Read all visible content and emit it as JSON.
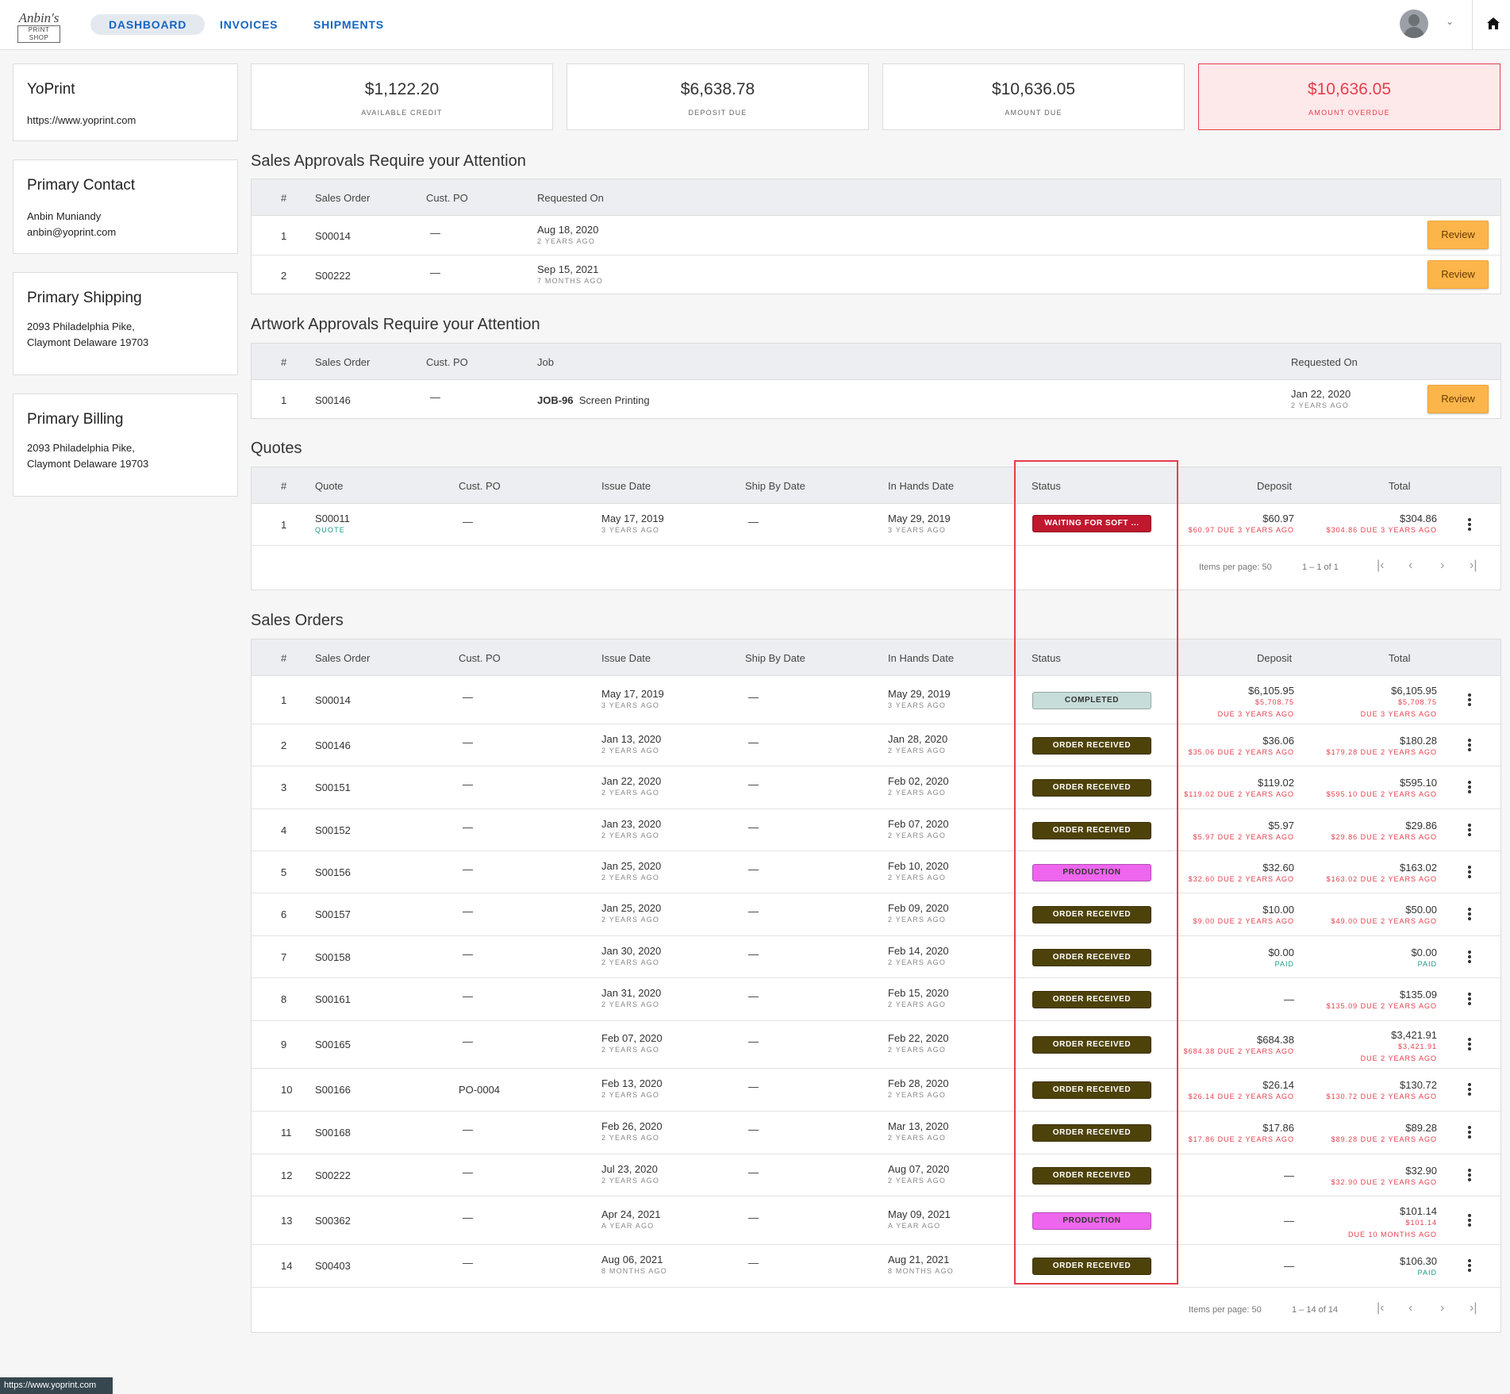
{
  "app": {
    "logo_line1": "Anbin's",
    "logo_line2": "PRINT SHOP"
  },
  "nav": [
    {
      "label": "DASHBOARD"
    },
    {
      "label": "INVOICES"
    },
    {
      "label": "SHIPMENTS"
    }
  ],
  "sidebar": {
    "company": {
      "title": "YoPrint",
      "url": "https://www.yoprint.com"
    },
    "contact": {
      "title": "Primary Contact",
      "name": "Anbin Muniandy",
      "email": "anbin@yoprint.com"
    },
    "shipping": {
      "title": "Primary Shipping",
      "line1": "2093 Philadelphia Pike,",
      "line2": "Claymont Delaware 19703"
    },
    "billing": {
      "title": "Primary Billing",
      "line1": "2093 Philadelphia Pike,",
      "line2": "Claymont Delaware 19703"
    }
  },
  "stats": [
    {
      "value": "$1,122.20",
      "label": "AVAILABLE CREDIT"
    },
    {
      "value": "$6,638.78",
      "label": "DEPOSIT DUE"
    },
    {
      "value": "$10,636.05",
      "label": "AMOUNT DUE"
    },
    {
      "value": "$10,636.05",
      "label": "AMOUNT OVERDUE"
    }
  ],
  "sales_approvals": {
    "title": "Sales Approvals Require your Attention",
    "headers": [
      "#",
      "Sales Order",
      "Cust. PO",
      "Requested On"
    ],
    "rows": [
      {
        "n": "1",
        "so": "S00014",
        "po": "—",
        "date": "Aug 18, 2020",
        "ago": "2 YEARS AGO",
        "action": "Review"
      },
      {
        "n": "2",
        "so": "S00222",
        "po": "—",
        "date": "Sep 15, 2021",
        "ago": "7 MONTHS AGO",
        "action": "Review"
      }
    ]
  },
  "artwork_approvals": {
    "title": "Artwork Approvals Require your Attention",
    "headers": [
      "#",
      "Sales Order",
      "Cust. PO",
      "Job",
      "Requested On"
    ],
    "rows": [
      {
        "n": "1",
        "so": "S00146",
        "po": "—",
        "job": "JOB-96",
        "job_desc": "Screen Printing",
        "date": "Jan 22, 2020",
        "ago": "2 YEARS AGO",
        "action": "Review"
      }
    ]
  },
  "quotes": {
    "title": "Quotes",
    "headers": [
      "#",
      "Quote",
      "Cust. PO",
      "Issue Date",
      "Ship By Date",
      "In Hands Date",
      "Status",
      "Deposit",
      "Total"
    ],
    "rows": [
      {
        "n": "1",
        "id": "S00011",
        "tag": "QUOTE",
        "po": "—",
        "issue": "May 17, 2019",
        "issue_ago": "3 YEARS AGO",
        "ship": "—",
        "hands": "May 29, 2019",
        "hands_ago": "3 YEARS AGO",
        "status": "WAITING FOR SOFT ...",
        "deposit": "$60.97",
        "deposit_note": "$60.97 DUE 3 YEARS AGO",
        "total": "$304.86",
        "total_note": "$304.86 DUE 3 YEARS AGO"
      }
    ],
    "pager": {
      "label": "Items per page:",
      "per_page": "50",
      "range": "1 – 1 of 1"
    }
  },
  "sales_orders": {
    "title": "Sales Orders",
    "headers": [
      "#",
      "Sales Order",
      "Cust. PO",
      "Issue Date",
      "Ship By Date",
      "In Hands Date",
      "Status",
      "Deposit",
      "Total"
    ],
    "rows": [
      {
        "n": "1",
        "so": "S00014",
        "po": "—",
        "issue": "May 17, 2019",
        "issue_ago": "3 YEARS AGO",
        "ship": "—",
        "hands": "May 29, 2019",
        "hands_ago": "3 YEARS AGO",
        "status": "COMPLETED",
        "deposit": "$6,105.95",
        "deposit_note": "$5,708.75",
        "deposit_note2": "DUE 3 YEARS AGO",
        "total": "$6,105.95",
        "total_note": "$5,708.75",
        "total_note2": "DUE 3 YEARS AGO"
      },
      {
        "n": "2",
        "so": "S00146",
        "po": "—",
        "issue": "Jan 13, 2020",
        "issue_ago": "2 YEARS AGO",
        "ship": "—",
        "hands": "Jan 28, 2020",
        "hands_ago": "2 YEARS AGO",
        "status": "ORDER RECEIVED",
        "deposit": "$36.06",
        "deposit_note": "$35.06 DUE 2 YEARS AGO",
        "total": "$180.28",
        "total_note": "$179.28 DUE 2 YEARS AGO"
      },
      {
        "n": "3",
        "so": "S00151",
        "po": "—",
        "issue": "Jan 22, 2020",
        "issue_ago": "2 YEARS AGO",
        "ship": "—",
        "hands": "Feb 02, 2020",
        "hands_ago": "2 YEARS AGO",
        "status": "ORDER RECEIVED",
        "deposit": "$119.02",
        "deposit_note": "$119.02 DUE 2 YEARS AGO",
        "total": "$595.10",
        "total_note": "$595.10 DUE 2 YEARS AGO"
      },
      {
        "n": "4",
        "so": "S00152",
        "po": "—",
        "issue": "Jan 23, 2020",
        "issue_ago": "2 YEARS AGO",
        "ship": "—",
        "hands": "Feb 07, 2020",
        "hands_ago": "2 YEARS AGO",
        "status": "ORDER RECEIVED",
        "deposit": "$5.97",
        "deposit_note": "$5.97 DUE 2 YEARS AGO",
        "total": "$29.86",
        "total_note": "$29.86 DUE 2 YEARS AGO"
      },
      {
        "n": "5",
        "so": "S00156",
        "po": "—",
        "issue": "Jan 25, 2020",
        "issue_ago": "2 YEARS AGO",
        "ship": "—",
        "hands": "Feb 10, 2020",
        "hands_ago": "2 YEARS AGO",
        "status": "PRODUCTION",
        "deposit": "$32.60",
        "deposit_note": "$32.60 DUE 2 YEARS AGO",
        "total": "$163.02",
        "total_note": "$163.02 DUE 2 YEARS AGO"
      },
      {
        "n": "6",
        "so": "S00157",
        "po": "—",
        "issue": "Jan 25, 2020",
        "issue_ago": "2 YEARS AGO",
        "ship": "—",
        "hands": "Feb 09, 2020",
        "hands_ago": "2 YEARS AGO",
        "status": "ORDER RECEIVED",
        "deposit": "$10.00",
        "deposit_note": "$9.00 DUE 2 YEARS AGO",
        "total": "$50.00",
        "total_note": "$49.00 DUE 2 YEARS AGO"
      },
      {
        "n": "7",
        "so": "S00158",
        "po": "—",
        "issue": "Jan 30, 2020",
        "issue_ago": "2 YEARS AGO",
        "ship": "—",
        "hands": "Feb 14, 2020",
        "hands_ago": "2 YEARS AGO",
        "status": "ORDER RECEIVED",
        "deposit": "$0.00",
        "deposit_paid": "PAID",
        "total": "$0.00",
        "total_paid": "PAID"
      },
      {
        "n": "8",
        "so": "S00161",
        "po": "—",
        "issue": "Jan 31, 2020",
        "issue_ago": "2 YEARS AGO",
        "ship": "—",
        "hands": "Feb 15, 2020",
        "hands_ago": "2 YEARS AGO",
        "status": "ORDER RECEIVED",
        "deposit": "—",
        "total": "$135.09",
        "total_note": "$135.09 DUE 2 YEARS AGO"
      },
      {
        "n": "9",
        "so": "S00165",
        "po": "—",
        "issue": "Feb 07, 2020",
        "issue_ago": "2 YEARS AGO",
        "ship": "—",
        "hands": "Feb 22, 2020",
        "hands_ago": "2 YEARS AGO",
        "status": "ORDER RECEIVED",
        "deposit": "$684.38",
        "deposit_note": "$684.38 DUE 2 YEARS AGO",
        "total": "$3,421.91",
        "total_note": "$3,421.91",
        "total_note2": "DUE 2 YEARS AGO"
      },
      {
        "n": "10",
        "so": "S00166",
        "po": "PO-0004",
        "issue": "Feb 13, 2020",
        "issue_ago": "2 YEARS AGO",
        "ship": "—",
        "hands": "Feb 28, 2020",
        "hands_ago": "2 YEARS AGO",
        "status": "ORDER RECEIVED",
        "deposit": "$26.14",
        "deposit_note": "$26.14 DUE 2 YEARS AGO",
        "total": "$130.72",
        "total_note": "$130.72 DUE 2 YEARS AGO"
      },
      {
        "n": "11",
        "so": "S00168",
        "po": "—",
        "issue": "Feb 26, 2020",
        "issue_ago": "2 YEARS AGO",
        "ship": "—",
        "hands": "Mar 13, 2020",
        "hands_ago": "2 YEARS AGO",
        "status": "ORDER RECEIVED",
        "deposit": "$17.86",
        "deposit_note": "$17.86 DUE 2 YEARS AGO",
        "total": "$89.28",
        "total_note": "$89.28 DUE 2 YEARS AGO"
      },
      {
        "n": "12",
        "so": "S00222",
        "po": "—",
        "issue": "Jul 23, 2020",
        "issue_ago": "2 YEARS AGO",
        "ship": "—",
        "hands": "Aug 07, 2020",
        "hands_ago": "2 YEARS AGO",
        "status": "ORDER RECEIVED",
        "deposit": "—",
        "total": "$32.90",
        "total_note": "$32.90 DUE 2 YEARS AGO"
      },
      {
        "n": "13",
        "so": "S00362",
        "po": "—",
        "issue": "Apr 24, 2021",
        "issue_ago": "A YEAR AGO",
        "ship": "—",
        "hands": "May 09, 2021",
        "hands_ago": "A YEAR AGO",
        "status": "PRODUCTION",
        "deposit": "—",
        "total": "$101.14",
        "total_note": "$101.14",
        "total_note2": "DUE 10 MONTHS AGO"
      },
      {
        "n": "14",
        "so": "S00403",
        "po": "—",
        "issue": "Aug 06, 2021",
        "issue_ago": "8 MONTHS AGO",
        "ship": "—",
        "hands": "Aug 21, 2021",
        "hands_ago": "8 MONTHS AGO",
        "status": "ORDER RECEIVED",
        "deposit": "—",
        "total": "$106.30",
        "total_paid": "PAID"
      }
    ],
    "pager": {
      "label": "Items per page:",
      "per_page": "50",
      "range": "1 – 14 of 14"
    }
  },
  "status_colors": {
    "WAITING FOR SOFT ...": {
      "bg": "#c0182e",
      "fg": "#ffffff"
    },
    "COMPLETED": {
      "bg": "#c7ddd9",
      "fg": "#333333"
    },
    "ORDER RECEIVED": {
      "bg": "#4e420b",
      "fg": "#ffffff"
    },
    "PRODUCTION": {
      "bg": "#ee66ee",
      "fg": "#333333"
    }
  },
  "browser_status": {
    "url": "https://www.yoprint.com"
  }
}
